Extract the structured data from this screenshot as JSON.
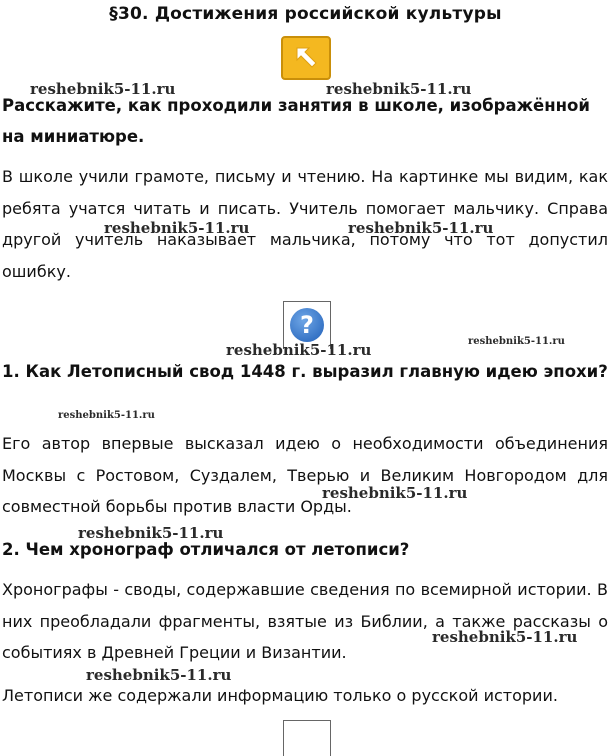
{
  "title": "§30. Достижения российской культуры",
  "watermark": "reshebnik5-11.ru",
  "help_glyph": "?",
  "sections": [
    {
      "question": "Расскажите, как проходили занятия в школе, изображённой на миниатюре.",
      "answer": "В школе учили грамоте, письму и чтению. На картинке мы видим, как ребята учатся читать и писать. Учитель помогает мальчику. Справа другой учитель наказывает мальчика, потому что тот допустил ошибку."
    },
    {
      "question": "1. Как Летописный свод 1448 г. выразил главную идею эпохи?",
      "answer": "Его автор впервые высказал идею о необходимости объединения Москвы с Ростовом, Суздалем, Тверью и Великим Новгородом для совместной борьбы против власти Орды."
    },
    {
      "question": "2. Чем хронограф отличался от летописи?",
      "answer": "Хронографы - своды, содержавшие сведения по всемирной истории. В них преобладали фрагменты, взятые из Библии, а также рассказы о событиях в Древней Греции и Византии.",
      "answer_extra": "Летописи же содержали информацию только о русской истории."
    }
  ]
}
